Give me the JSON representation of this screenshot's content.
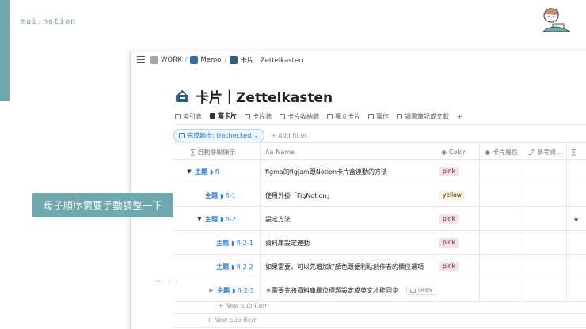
{
  "brand": "mai.notion",
  "breadcrumb": {
    "items": [
      {
        "label": "WORK"
      },
      {
        "label": "Memo"
      },
      {
        "label": "卡片｜Zettelkasten"
      }
    ]
  },
  "page": {
    "title": "卡片｜Zettelkasten"
  },
  "tabs": [
    {
      "label": "索引表",
      "active": false
    },
    {
      "label": "寫卡片",
      "active": true
    },
    {
      "label": "卡片牆",
      "active": false
    },
    {
      "label": "卡片收納牆",
      "active": false
    },
    {
      "label": "獨立卡片",
      "active": false
    },
    {
      "label": "實作",
      "active": false
    },
    {
      "label": "讀書筆記或文獻",
      "active": false
    }
  ],
  "filter": {
    "pill": "完成輸出: Unchecked",
    "add": "Add filter"
  },
  "columns": [
    "自動層級顯示",
    "Name",
    "Color",
    "卡片屬性",
    "參考資..."
  ],
  "rows": [
    {
      "topic": "主題",
      "ref": "fi",
      "name": "figma的figjam跟Notion卡片盒連動的方法",
      "color": "pink",
      "extra": ""
    },
    {
      "topic": "主題",
      "ref": "fi-1",
      "name": "使用外掛「FigNotion」",
      "color": "yellow",
      "extra": ""
    },
    {
      "topic": "主題",
      "ref": "fi-2",
      "name": "設定方法",
      "color": "pink",
      "extra": "★"
    },
    {
      "topic": "主題",
      "ref": "fi-2-1",
      "name": "資料庫設定連動",
      "color": "pink",
      "extra": ""
    },
    {
      "topic": "主題",
      "ref": "fi-2-2",
      "name": "如果需要，可以先增加好顏色跟便利貼創作者的欄位選項",
      "color": "pink",
      "extra": ""
    },
    {
      "topic": "主題",
      "ref": "fi-2-3",
      "name": "＊需要先將資料庫欄位標題設定成英文才能同步",
      "color": "",
      "extra": ""
    }
  ],
  "open_button": "OPEN",
  "new_sub_item": "New sub-item",
  "caption": "母子順序需要手動調整一下",
  "colors": {
    "accent": "#6fa8ad",
    "link": "#2e7cd1",
    "pink_tag": "#f5e0e9",
    "yellow_tag": "#fbf3db"
  }
}
